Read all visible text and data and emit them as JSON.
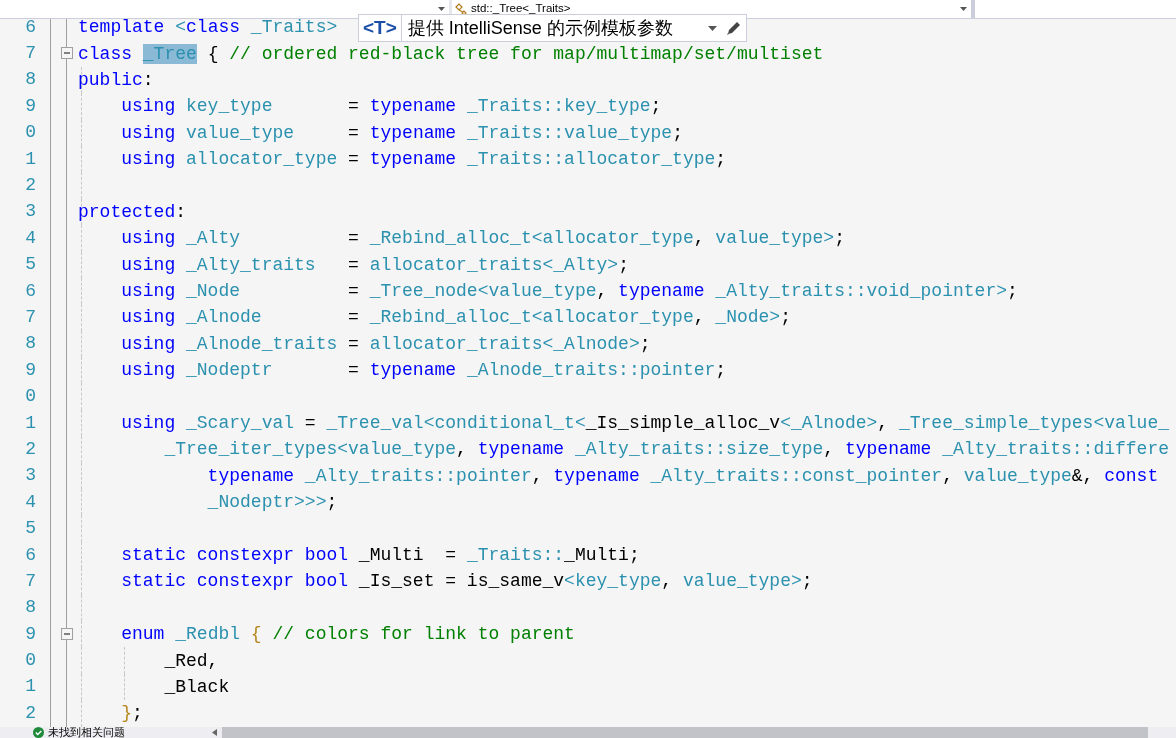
{
  "navigation_bar": {
    "member_dropdown": {
      "value": "std::_Tree<_Traits>"
    }
  },
  "quick_info": {
    "badge": "<T>",
    "text": "提供 IntelliSense 的示例模板参数"
  },
  "editor": {
    "lines": [
      {
        "number": "6",
        "tokens": [
          {
            "kind": "keyword",
            "text": "template"
          },
          {
            "kind": "type",
            "text": " <"
          },
          {
            "kind": "keyword",
            "text": "class"
          },
          {
            "kind": "type",
            "text": " _Traits>"
          }
        ]
      },
      {
        "number": "7",
        "expanded": true,
        "tokens": [
          {
            "kind": "keyword",
            "text": "class "
          },
          {
            "kind": "type",
            "text": "_Tree",
            "highlighted": true
          },
          {
            "kind": "plain",
            "text": " { "
          },
          {
            "kind": "comment",
            "text": "// ordered red-black tree for map/multimap/set/multiset"
          }
        ]
      },
      {
        "number": "8",
        "tokens": [
          {
            "kind": "keyword",
            "text": "public"
          },
          {
            "kind": "plain",
            "text": ":"
          }
        ]
      },
      {
        "number": "9",
        "tokens": [
          {
            "kind": "keyword",
            "text": "    using"
          },
          {
            "kind": "type",
            "text": " key_type"
          },
          {
            "kind": "plain",
            "text": "       = "
          },
          {
            "kind": "keyword",
            "text": "typename"
          },
          {
            "kind": "type",
            "text": " _Traits::key_type"
          },
          {
            "kind": "plain",
            "text": ";"
          }
        ]
      },
      {
        "number": "0",
        "tokens": [
          {
            "kind": "keyword",
            "text": "    using"
          },
          {
            "kind": "type",
            "text": " value_type"
          },
          {
            "kind": "plain",
            "text": "     = "
          },
          {
            "kind": "keyword",
            "text": "typename"
          },
          {
            "kind": "type",
            "text": " _Traits::value_type"
          },
          {
            "kind": "plain",
            "text": ";"
          }
        ]
      },
      {
        "number": "1",
        "tokens": [
          {
            "kind": "keyword",
            "text": "    using"
          },
          {
            "kind": "type",
            "text": " allocator_type"
          },
          {
            "kind": "plain",
            "text": " = "
          },
          {
            "kind": "keyword",
            "text": "typename"
          },
          {
            "kind": "type",
            "text": " _Traits::allocator_type"
          },
          {
            "kind": "plain",
            "text": ";"
          }
        ]
      },
      {
        "number": "2"
      },
      {
        "number": "3",
        "tokens": [
          {
            "kind": "keyword",
            "text": "protected"
          },
          {
            "kind": "plain",
            "text": ":"
          }
        ]
      },
      {
        "number": "4",
        "tokens": [
          {
            "kind": "keyword",
            "text": "    using"
          },
          {
            "kind": "type",
            "text": " _Alty"
          },
          {
            "kind": "plain",
            "text": "          = "
          },
          {
            "kind": "type",
            "text": "_Rebind_alloc_t<allocator_type"
          },
          {
            "kind": "plain",
            "text": ", "
          },
          {
            "kind": "type",
            "text": "value_type>"
          },
          {
            "kind": "plain",
            "text": ";"
          }
        ]
      },
      {
        "number": "5",
        "tokens": [
          {
            "kind": "keyword",
            "text": "    using"
          },
          {
            "kind": "type",
            "text": " _Alty_traits"
          },
          {
            "kind": "plain",
            "text": "   = "
          },
          {
            "kind": "type",
            "text": "allocator_traits<_Alty>"
          },
          {
            "kind": "plain",
            "text": ";"
          }
        ]
      },
      {
        "number": "6",
        "tokens": [
          {
            "kind": "keyword",
            "text": "    using"
          },
          {
            "kind": "type",
            "text": " _Node"
          },
          {
            "kind": "plain",
            "text": "          = "
          },
          {
            "kind": "type",
            "text": "_Tree_node<value_type"
          },
          {
            "kind": "plain",
            "text": ", "
          },
          {
            "kind": "keyword",
            "text": "typename"
          },
          {
            "kind": "type",
            "text": " _Alty_traits::void_pointer>"
          },
          {
            "kind": "plain",
            "text": ";"
          }
        ]
      },
      {
        "number": "7",
        "tokens": [
          {
            "kind": "keyword",
            "text": "    using"
          },
          {
            "kind": "type",
            "text": " _Alnode"
          },
          {
            "kind": "plain",
            "text": "        = "
          },
          {
            "kind": "type",
            "text": "_Rebind_alloc_t<allocator_type"
          },
          {
            "kind": "plain",
            "text": ", "
          },
          {
            "kind": "type",
            "text": "_Node>"
          },
          {
            "kind": "plain",
            "text": ";"
          }
        ]
      },
      {
        "number": "8",
        "tokens": [
          {
            "kind": "keyword",
            "text": "    using"
          },
          {
            "kind": "type",
            "text": " _Alnode_traits"
          },
          {
            "kind": "plain",
            "text": " = "
          },
          {
            "kind": "type",
            "text": "allocator_traits<_Alnode>"
          },
          {
            "kind": "plain",
            "text": ";"
          }
        ]
      },
      {
        "number": "9",
        "tokens": [
          {
            "kind": "keyword",
            "text": "    using"
          },
          {
            "kind": "type",
            "text": " _Nodeptr"
          },
          {
            "kind": "plain",
            "text": "       = "
          },
          {
            "kind": "keyword",
            "text": "typename"
          },
          {
            "kind": "type",
            "text": " _Alnode_traits::pointer"
          },
          {
            "kind": "plain",
            "text": ";"
          }
        ]
      },
      {
        "number": "0"
      },
      {
        "number": "1",
        "tokens": [
          {
            "kind": "keyword",
            "text": "    using"
          },
          {
            "kind": "type",
            "text": " _Scary_val"
          },
          {
            "kind": "plain",
            "text": " = "
          },
          {
            "kind": "type",
            "text": "_Tree_val<conditional_t<"
          },
          {
            "kind": "plain",
            "text": "_Is_simple_alloc_v"
          },
          {
            "kind": "type",
            "text": "<_Alnode>"
          },
          {
            "kind": "plain",
            "text": ", "
          },
          {
            "kind": "type",
            "text": "_Tree_simple_types<value_"
          }
        ]
      },
      {
        "number": "2",
        "tokens": [
          {
            "kind": "type",
            "text": "        _Tree_iter_types<value_type"
          },
          {
            "kind": "plain",
            "text": ", "
          },
          {
            "kind": "keyword",
            "text": "typename"
          },
          {
            "kind": "type",
            "text": " _Alty_traits::size_type"
          },
          {
            "kind": "plain",
            "text": ", "
          },
          {
            "kind": "keyword",
            "text": "typename"
          },
          {
            "kind": "type",
            "text": " _Alty_traits::differe"
          }
        ]
      },
      {
        "number": "3",
        "tokens": [
          {
            "kind": "keyword",
            "text": "            typename"
          },
          {
            "kind": "type",
            "text": " _Alty_traits::pointer"
          },
          {
            "kind": "plain",
            "text": ", "
          },
          {
            "kind": "keyword",
            "text": "typename"
          },
          {
            "kind": "type",
            "text": " _Alty_traits::const_pointer"
          },
          {
            "kind": "plain",
            "text": ", "
          },
          {
            "kind": "type",
            "text": "value_type"
          },
          {
            "kind": "plain",
            "text": "&, "
          },
          {
            "kind": "keyword",
            "text": "const"
          }
        ]
      },
      {
        "number": "4",
        "tokens": [
          {
            "kind": "type",
            "text": "            _Nodeptr>>>"
          },
          {
            "kind": "plain",
            "text": ";"
          }
        ]
      },
      {
        "number": "5"
      },
      {
        "number": "6",
        "tokens": [
          {
            "kind": "keyword",
            "text": "    static constexpr bool"
          },
          {
            "kind": "plain",
            "text": " _Multi  = "
          },
          {
            "kind": "type",
            "text": "_Traits::"
          },
          {
            "kind": "plain",
            "text": "_Multi;"
          }
        ]
      },
      {
        "number": "7",
        "tokens": [
          {
            "kind": "keyword",
            "text": "    static constexpr bool"
          },
          {
            "kind": "plain",
            "text": " _Is_set = is_same_v"
          },
          {
            "kind": "type",
            "text": "<key_type"
          },
          {
            "kind": "plain",
            "text": ", "
          },
          {
            "kind": "type",
            "text": "value_type>"
          },
          {
            "kind": "plain",
            "text": ";"
          }
        ]
      },
      {
        "number": "8"
      },
      {
        "number": "9",
        "expanded": true,
        "tokens": [
          {
            "kind": "keyword",
            "text": "    enum"
          },
          {
            "kind": "type",
            "text": " _Redbl"
          },
          {
            "kind": "punct",
            "text": " { "
          },
          {
            "kind": "comment",
            "text": "// colors for link to parent"
          }
        ]
      },
      {
        "number": "0",
        "tokens": [
          {
            "kind": "plain",
            "text": "        _Red,"
          }
        ]
      },
      {
        "number": "1",
        "tokens": [
          {
            "kind": "plain",
            "text": "        _Black"
          }
        ]
      },
      {
        "number": "2",
        "tokens": [
          {
            "kind": "punct",
            "text": "    }"
          },
          {
            "kind": "plain",
            "text": ";"
          }
        ]
      }
    ]
  },
  "status_bar": {
    "issues": "未找到相关问题"
  }
}
